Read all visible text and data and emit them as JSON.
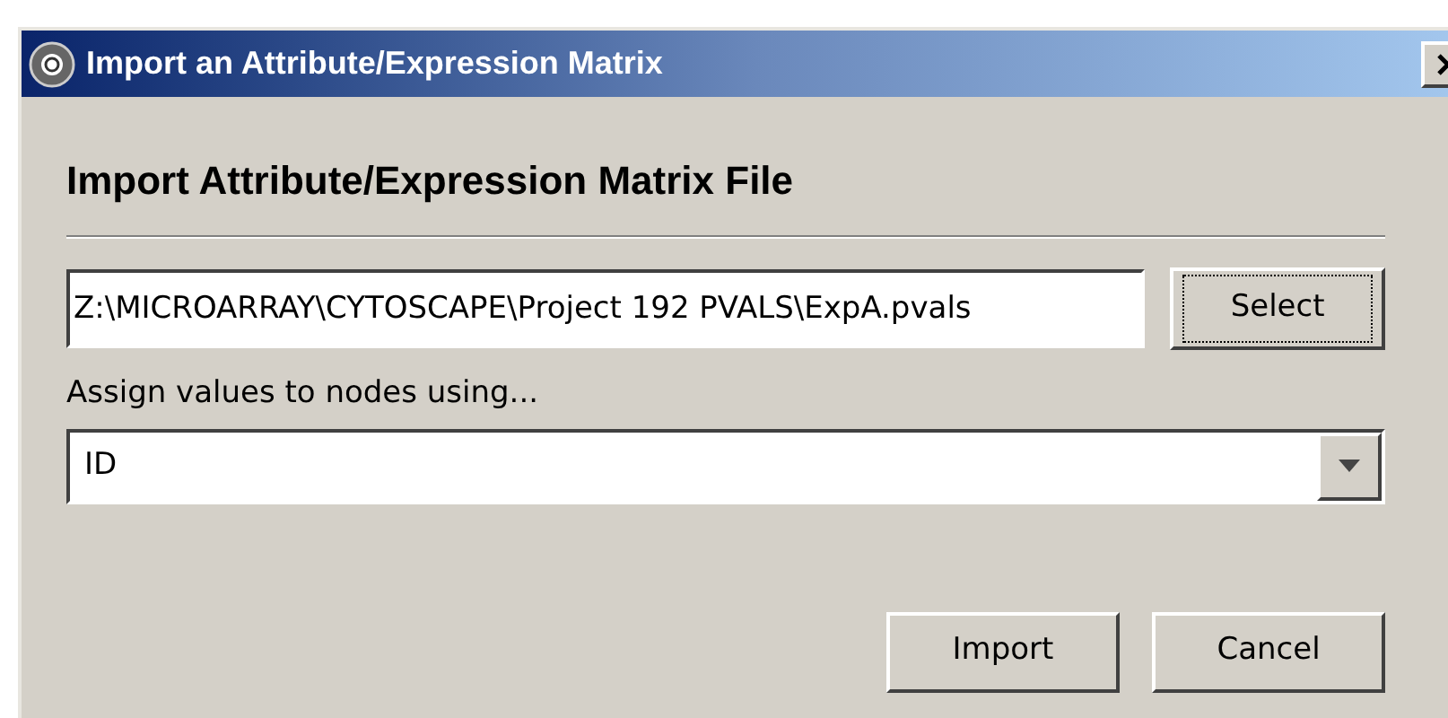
{
  "window": {
    "title": "Import an Attribute/Expression Matrix"
  },
  "heading": "Import Attribute/Expression Matrix File",
  "file_field": {
    "value": "Z:\\MICROARRAY\\CYTOSCAPE\\Project 192 PVALS\\ExpA.pvals"
  },
  "select_button": {
    "label": "Select",
    "focused": true
  },
  "assign": {
    "label": "Assign values to nodes using...",
    "value": "ID"
  },
  "buttons": [
    {
      "label": "Import"
    },
    {
      "label": "Cancel"
    }
  ]
}
